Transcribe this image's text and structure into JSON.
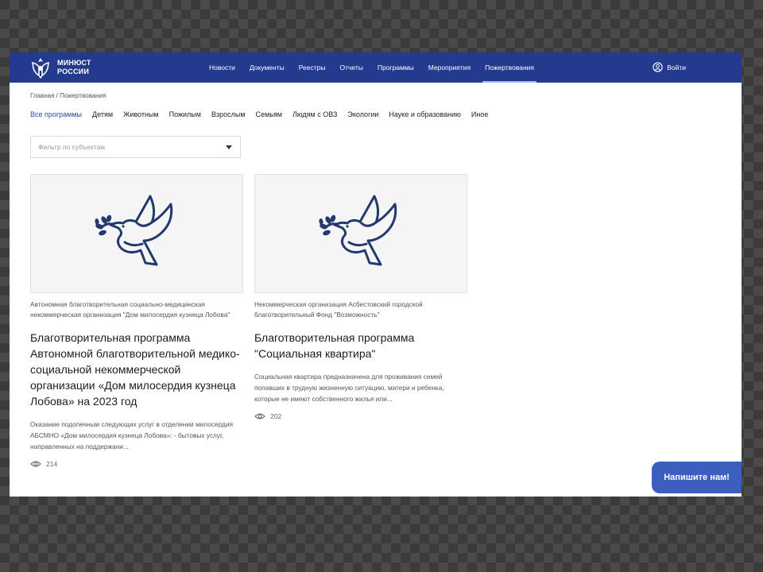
{
  "header": {
    "logo_line1": "МИНЮСТ",
    "logo_line2": "РОССИИ",
    "nav": [
      "Новости",
      "Документы",
      "Реестры",
      "Отчеты",
      "Программы",
      "Мероприятия",
      "Пожертвования"
    ],
    "active_nav_index": 6,
    "login_label": "Войти"
  },
  "breadcrumb": "Главная / Пожертвования",
  "filters": [
    "Все программы",
    "Детям",
    "Животным",
    "Пожилым",
    "Взрослым",
    "Семьям",
    "Людям с ОВЗ",
    "Экологии",
    "Науке и образованию",
    "Иное"
  ],
  "filter_select": {
    "placeholder": "Фильтр по субъектам"
  },
  "cards": [
    {
      "org": "Автономная благотворительная социально-медицинская некоммерческая организация \"Дом милосердия кузнеца Лобова\"",
      "title": "Благотворительная программа Автономной благотворительной медико-социальной некоммерческой организации «Дом милосердия кузнеца Лобова» на 2023 год",
      "desc": "Оказание подопечным следующих услуг в отделении милосердия АБСМНО «Дом милосердия кузнеца Лобова»: - бытовых услуг, направленных на поддержани...",
      "views": "214"
    },
    {
      "org": "Некоммерческая организация Асбестовский городской благотворительный Фонд \"Возможность\"",
      "title": "Благотворительная программа \"Социальная квартира\"",
      "desc": "Социальная квартира предназначена для проживания семей попавших в трудную жизненную ситуацию, матери и ребенка, которые не имеют собственного жилья или...",
      "views": "202"
    }
  ],
  "chat_button": "Напишите нам!",
  "colors": {
    "header": "#243a8f",
    "accent": "#2c4aa6",
    "chat": "#3c5fbf",
    "dove": "#243a6e"
  },
  "icons": [
    "logo-emblem-icon",
    "user-circle-icon",
    "dove-icon",
    "eye-icon",
    "chevron-down-icon"
  ]
}
